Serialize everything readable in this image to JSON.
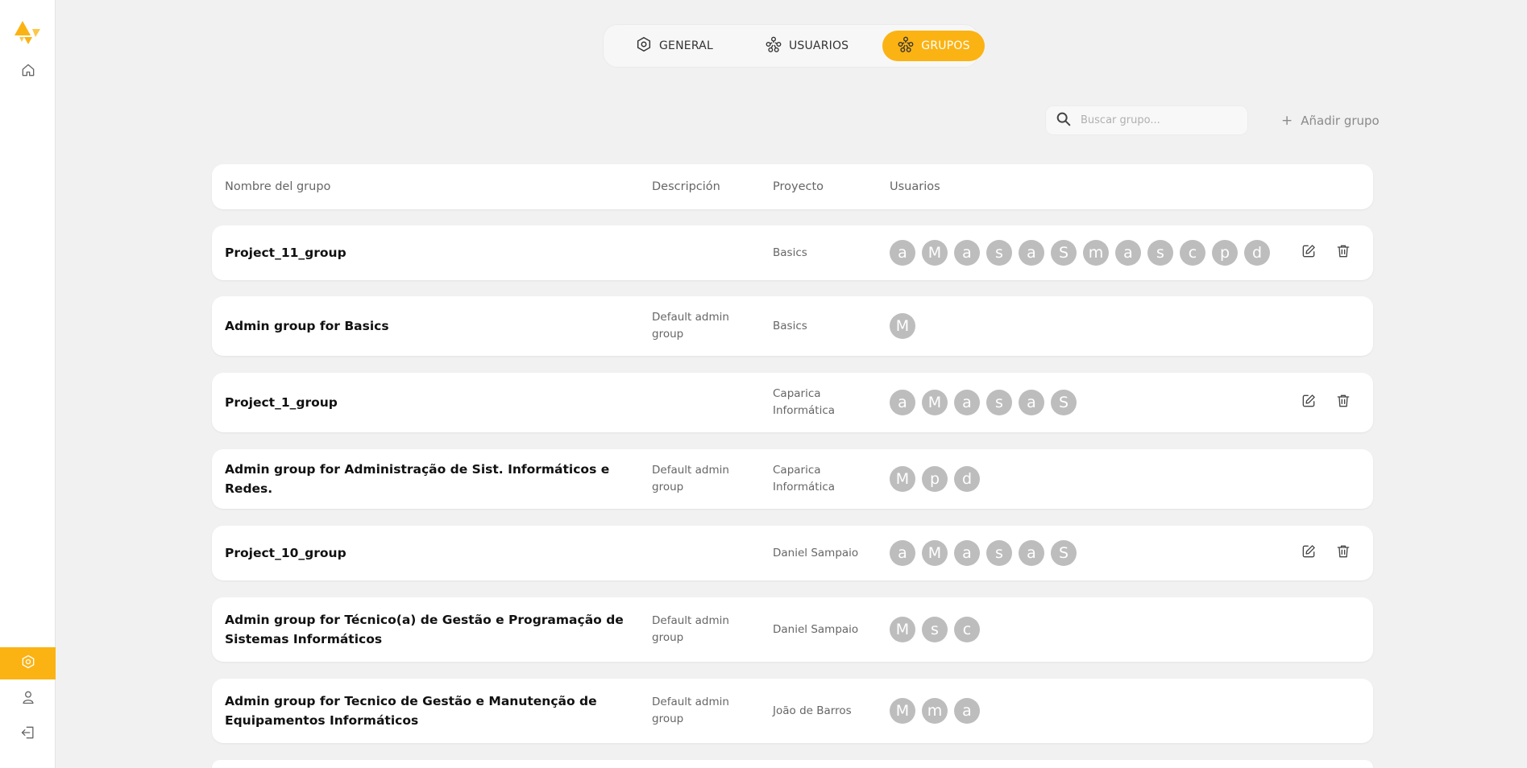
{
  "tabs": [
    {
      "label": "GENERAL",
      "icon": "settings-hexagon-icon",
      "active": false
    },
    {
      "label": "USUARIOS",
      "icon": "users-network-icon",
      "active": false
    },
    {
      "label": "GRUPOS",
      "icon": "users-network-icon",
      "active": true
    }
  ],
  "search": {
    "placeholder": "Buscar grupo..."
  },
  "add_group": {
    "label": "Añadir grupo"
  },
  "columns": {
    "name": "Nombre del grupo",
    "description": "Descripción",
    "project": "Proyecto",
    "users": "Usuarios"
  },
  "colors": {
    "accent": "#fbb313",
    "avatar": "#bdbdbd",
    "background": "#f1f1f1"
  },
  "groups": [
    {
      "name": "Project_11_group",
      "description": "",
      "project": "Basics",
      "users": [
        "a",
        "M",
        "a",
        "s",
        "a",
        "S",
        "m",
        "a",
        "s",
        "c",
        "p",
        "d"
      ],
      "actions": true
    },
    {
      "name": "Admin group for Basics",
      "description": "Default admin group",
      "project": "Basics",
      "users": [
        "M"
      ],
      "actions": false
    },
    {
      "name": "Project_1_group",
      "description": "",
      "project": "Caparica Informática",
      "users": [
        "a",
        "M",
        "a",
        "s",
        "a",
        "S"
      ],
      "actions": true
    },
    {
      "name": "Admin group for Administração de Sist. Informáticos e Redes.",
      "description": "Default admin group",
      "project": "Caparica Informática",
      "users": [
        "M",
        "p",
        "d"
      ],
      "actions": false
    },
    {
      "name": "Project_10_group",
      "description": "",
      "project": "Daniel Sampaio",
      "users": [
        "a",
        "M",
        "a",
        "s",
        "a",
        "S"
      ],
      "actions": true
    },
    {
      "name": "Admin group for Técnico(a) de Gestão e Programação de Sistemas Informáticos",
      "description": "Default admin group",
      "project": "Daniel Sampaio",
      "users": [
        "M",
        "s",
        "c"
      ],
      "actions": false
    },
    {
      "name": "Admin group for Tecnico de Gestão e Manutenção de Equipamentos Informáticos",
      "description": "Default admin group",
      "project": "João de Barros",
      "users": [
        "M",
        "m",
        "a"
      ],
      "actions": false
    }
  ]
}
